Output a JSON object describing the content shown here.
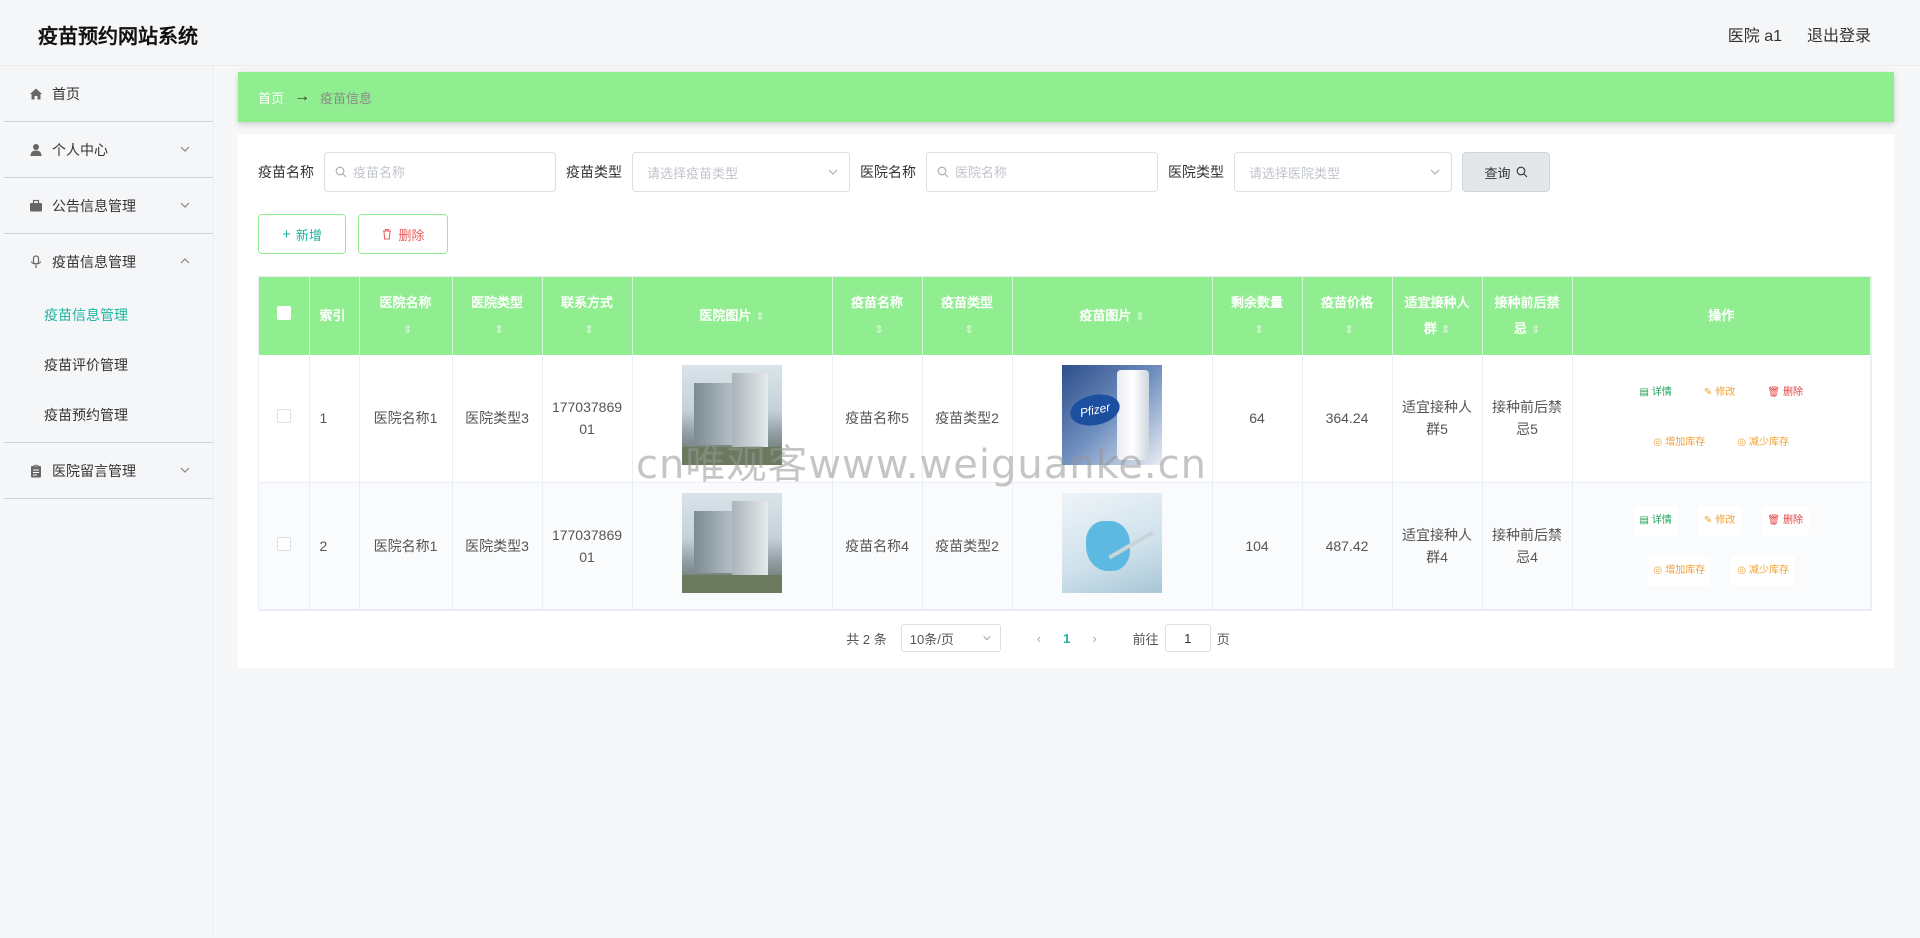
{
  "header": {
    "app_title": "疫苗预约网站系统",
    "user": "医院 a1",
    "logout": "退出登录"
  },
  "sidebar": {
    "home": "首页",
    "personal_center": "个人中心",
    "notice_mgmt": "公告信息管理",
    "vaccine_mgmt": "疫苗信息管理",
    "vaccine_sub": [
      "疫苗信息管理",
      "疫苗评价管理",
      "疫苗预约管理"
    ],
    "hospital_msg": "医院留言管理"
  },
  "breadcrumb": {
    "home": "首页",
    "sep": "→",
    "current": "疫苗信息"
  },
  "search": {
    "vaccine_name_label": "疫苗名称",
    "vaccine_name_placeholder": "疫苗名称",
    "vaccine_type_label": "疫苗类型",
    "vaccine_type_placeholder": "请选择疫苗类型",
    "hospital_name_label": "医院名称",
    "hospital_name_placeholder": "医院名称",
    "hospital_type_label": "医院类型",
    "hospital_type_placeholder": "请选择医院类型",
    "query_button": "查询"
  },
  "actions": {
    "add": "新增",
    "delete": "删除"
  },
  "table": {
    "headers": [
      "索引",
      "医院名称",
      "医院类型",
      "联系方式",
      "医院图片",
      "疫苗名称",
      "疫苗类型",
      "疫苗图片",
      "剩余数量",
      "疫苗价格",
      "适宜接种人群",
      "接种前后禁忌",
      "操作"
    ],
    "rows": [
      {
        "index": "1",
        "hospital_name": "医院名称1",
        "hospital_type": "医院类型3",
        "phone": "17703786901",
        "vaccine_name": "疫苗名称5",
        "vaccine_type": "疫苗类型2",
        "stock": "64",
        "price": "364.24",
        "crowd": "适宜接种人群5",
        "taboo": "接种前后禁忌5"
      },
      {
        "index": "2",
        "hospital_name": "医院名称1",
        "hospital_type": "医院类型3",
        "phone": "17703786901",
        "vaccine_name": "疫苗名称4",
        "vaccine_type": "疫苗类型2",
        "stock": "104",
        "price": "487.42",
        "crowd": "适宜接种人群4",
        "taboo": "接种前后禁忌4"
      }
    ],
    "ops": {
      "detail": "详情",
      "edit": "修改",
      "delete": "删除",
      "inc": "增加库存",
      "dec": "减少库存"
    }
  },
  "pager": {
    "total": "共 2 条",
    "size": "10条/页",
    "current": "1",
    "goto": "前往",
    "jump_value": "1",
    "page_suffix": "页"
  },
  "image_labels": {
    "vaccine1_brand": "Pfizer"
  },
  "watermark": "cn唯观客www.weiguanke.cn"
}
